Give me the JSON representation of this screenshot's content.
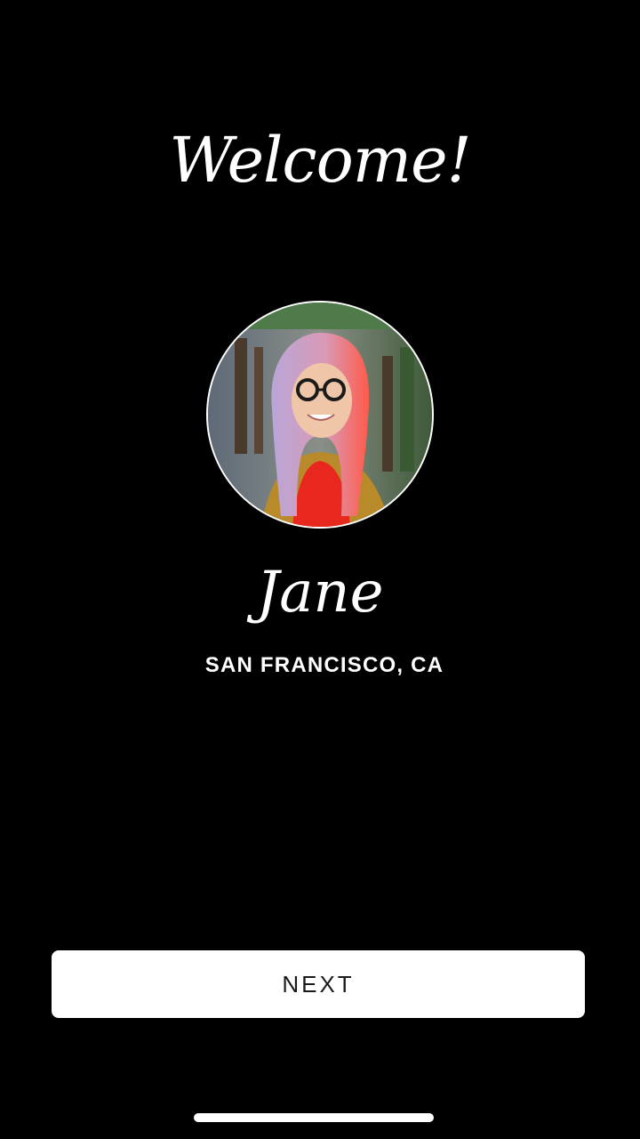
{
  "welcome": {
    "title": "Welcome!"
  },
  "profile": {
    "avatar_icon": "profile-photo",
    "name": "Jane",
    "location": "SAN FRANCISCO, CA"
  },
  "actions": {
    "next_label": "NEXT"
  },
  "colors": {
    "background": "#000000",
    "text": "#ffffff",
    "button_background": "#ffffff",
    "button_text": "#1a1a1a"
  }
}
